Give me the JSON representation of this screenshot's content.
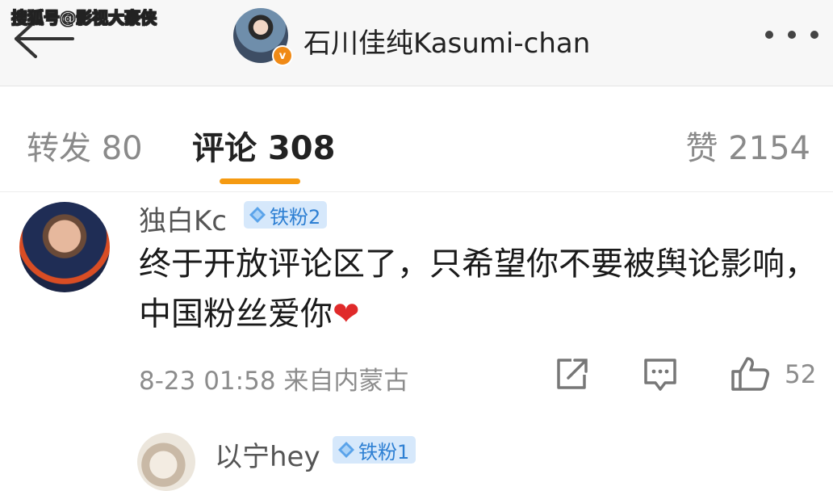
{
  "watermark": "搜狐号@影视大豪侠",
  "header": {
    "title": "石川佳纯Kasumi-chan",
    "verified_mark": "v"
  },
  "tabs": {
    "repost": "转发 80",
    "comments": "评论 308",
    "likes": "赞 2154"
  },
  "comments": [
    {
      "username": "独白Kc",
      "badge": "铁粉2",
      "text": "终于开放评论区了，只希望你不要被舆论影响，中国粉丝爱你",
      "emoji": "❤",
      "meta": "8-23 01:58 来自内蒙古",
      "likes": "52"
    },
    {
      "username": "以宁hey",
      "badge": "铁粉1"
    }
  ],
  "colors": {
    "accent": "#f59a11",
    "badge_bg": "#d6e8fb",
    "badge_text": "#2d7fd3",
    "verified": "#f08a16",
    "heart": "#e02a2a"
  }
}
